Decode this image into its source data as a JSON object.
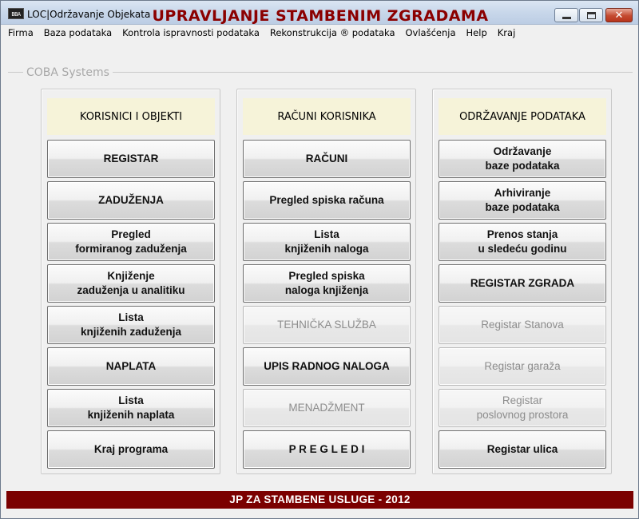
{
  "window": {
    "title": "LOC|Održavanje Objekata",
    "icon_text": "BBA"
  },
  "menu": [
    "Firma",
    "Baza podataka",
    "Kontrola ispravnosti podataka",
    "Rekonstrukcija ® podataka",
    "Ovlašćenja",
    "Help",
    "Kraj"
  ],
  "main_title": "UPRAVLJANJE STAMBENIM ZGRADAMA",
  "group_label": "COBA Systems",
  "panels": [
    {
      "header": "KORISNICI I OBJEKTI",
      "buttons": [
        {
          "label": "REGISTAR",
          "enabled": true
        },
        {
          "label": "ZADUŽENJA",
          "enabled": true
        },
        {
          "label": "Pregled\nformiranog zaduženja",
          "enabled": true
        },
        {
          "label": "Knjiženje\nzaduženja u analitiku",
          "enabled": true
        },
        {
          "label": "Lista\nknjiženih zaduženja",
          "enabled": true
        },
        {
          "label": "NAPLATA",
          "enabled": true
        },
        {
          "label": "Lista\nknjiženih naplata",
          "enabled": true
        },
        {
          "label": "Kraj programa",
          "enabled": true
        }
      ]
    },
    {
      "header": "RAČUNI KORISNIKA",
      "buttons": [
        {
          "label": "RAČUNI",
          "enabled": true
        },
        {
          "label": "Pregled spiska računa",
          "enabled": true
        },
        {
          "label": "Lista\nknjiženih naloga",
          "enabled": true
        },
        {
          "label": "Pregled spiska\nnaloga knjiženja",
          "enabled": true
        },
        {
          "label": "TEHNIČKA SLUŽBA",
          "enabled": false
        },
        {
          "label": "UPIS RADNOG NALOGA",
          "enabled": true
        },
        {
          "label": "MENADŽMENT",
          "enabled": false
        },
        {
          "label": "P R E G L E D I",
          "enabled": true
        }
      ]
    },
    {
      "header": "ODRŽAVANJE PODATAKA",
      "buttons": [
        {
          "label": "Održavanje\nbaze podataka",
          "enabled": true
        },
        {
          "label": "Arhiviranje\nbaze podataka",
          "enabled": true
        },
        {
          "label": "Prenos stanja\nu sledeću godinu",
          "enabled": true
        },
        {
          "label": "REGISTAR ZGRADA",
          "enabled": true
        },
        {
          "label": "Registar Stanova",
          "enabled": false
        },
        {
          "label": "Registar garaža",
          "enabled": false
        },
        {
          "label": "Registar\nposlovnog prostora",
          "enabled": false
        },
        {
          "label": "Registar ulica",
          "enabled": true
        }
      ]
    }
  ],
  "footer": "JP ZA STAMBENE USLUGE - 2012",
  "colors": {
    "title": "#8b0000",
    "footer_bg": "#7b0000",
    "panel_header_bg": "#f6f3d9"
  }
}
